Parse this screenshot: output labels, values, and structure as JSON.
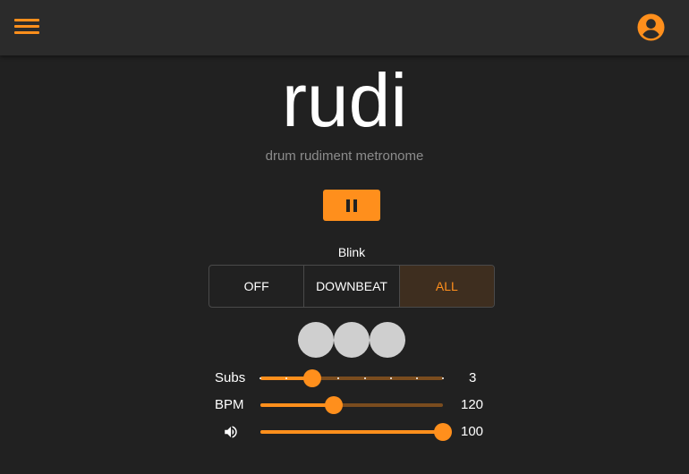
{
  "header": {
    "menu_icon": "hamburger-menu-icon",
    "account_icon": "account-circle-icon",
    "accent_color": "#ff8f1c",
    "background_color": "#2b2b2b"
  },
  "app": {
    "title": "rudi",
    "subtitle": "drum rudiment metronome"
  },
  "transport": {
    "state": "playing",
    "icon": "pause-icon"
  },
  "blink": {
    "label": "Blink",
    "options": [
      "OFF",
      "DOWNBEAT",
      "ALL"
    ],
    "selected": "ALL"
  },
  "beat_indicators": {
    "count": 3,
    "color": "#cfcfcf"
  },
  "sliders": {
    "subs": {
      "label": "Subs",
      "value": "3",
      "min": 1,
      "max": 8,
      "ticks": [
        1,
        2,
        3,
        4,
        5,
        6,
        7,
        8
      ]
    },
    "bpm": {
      "label": "BPM",
      "value": "120",
      "min": 40,
      "max": 240
    },
    "volume": {
      "icon": "volume-up-icon",
      "value": "100",
      "min": 0,
      "max": 100
    }
  }
}
